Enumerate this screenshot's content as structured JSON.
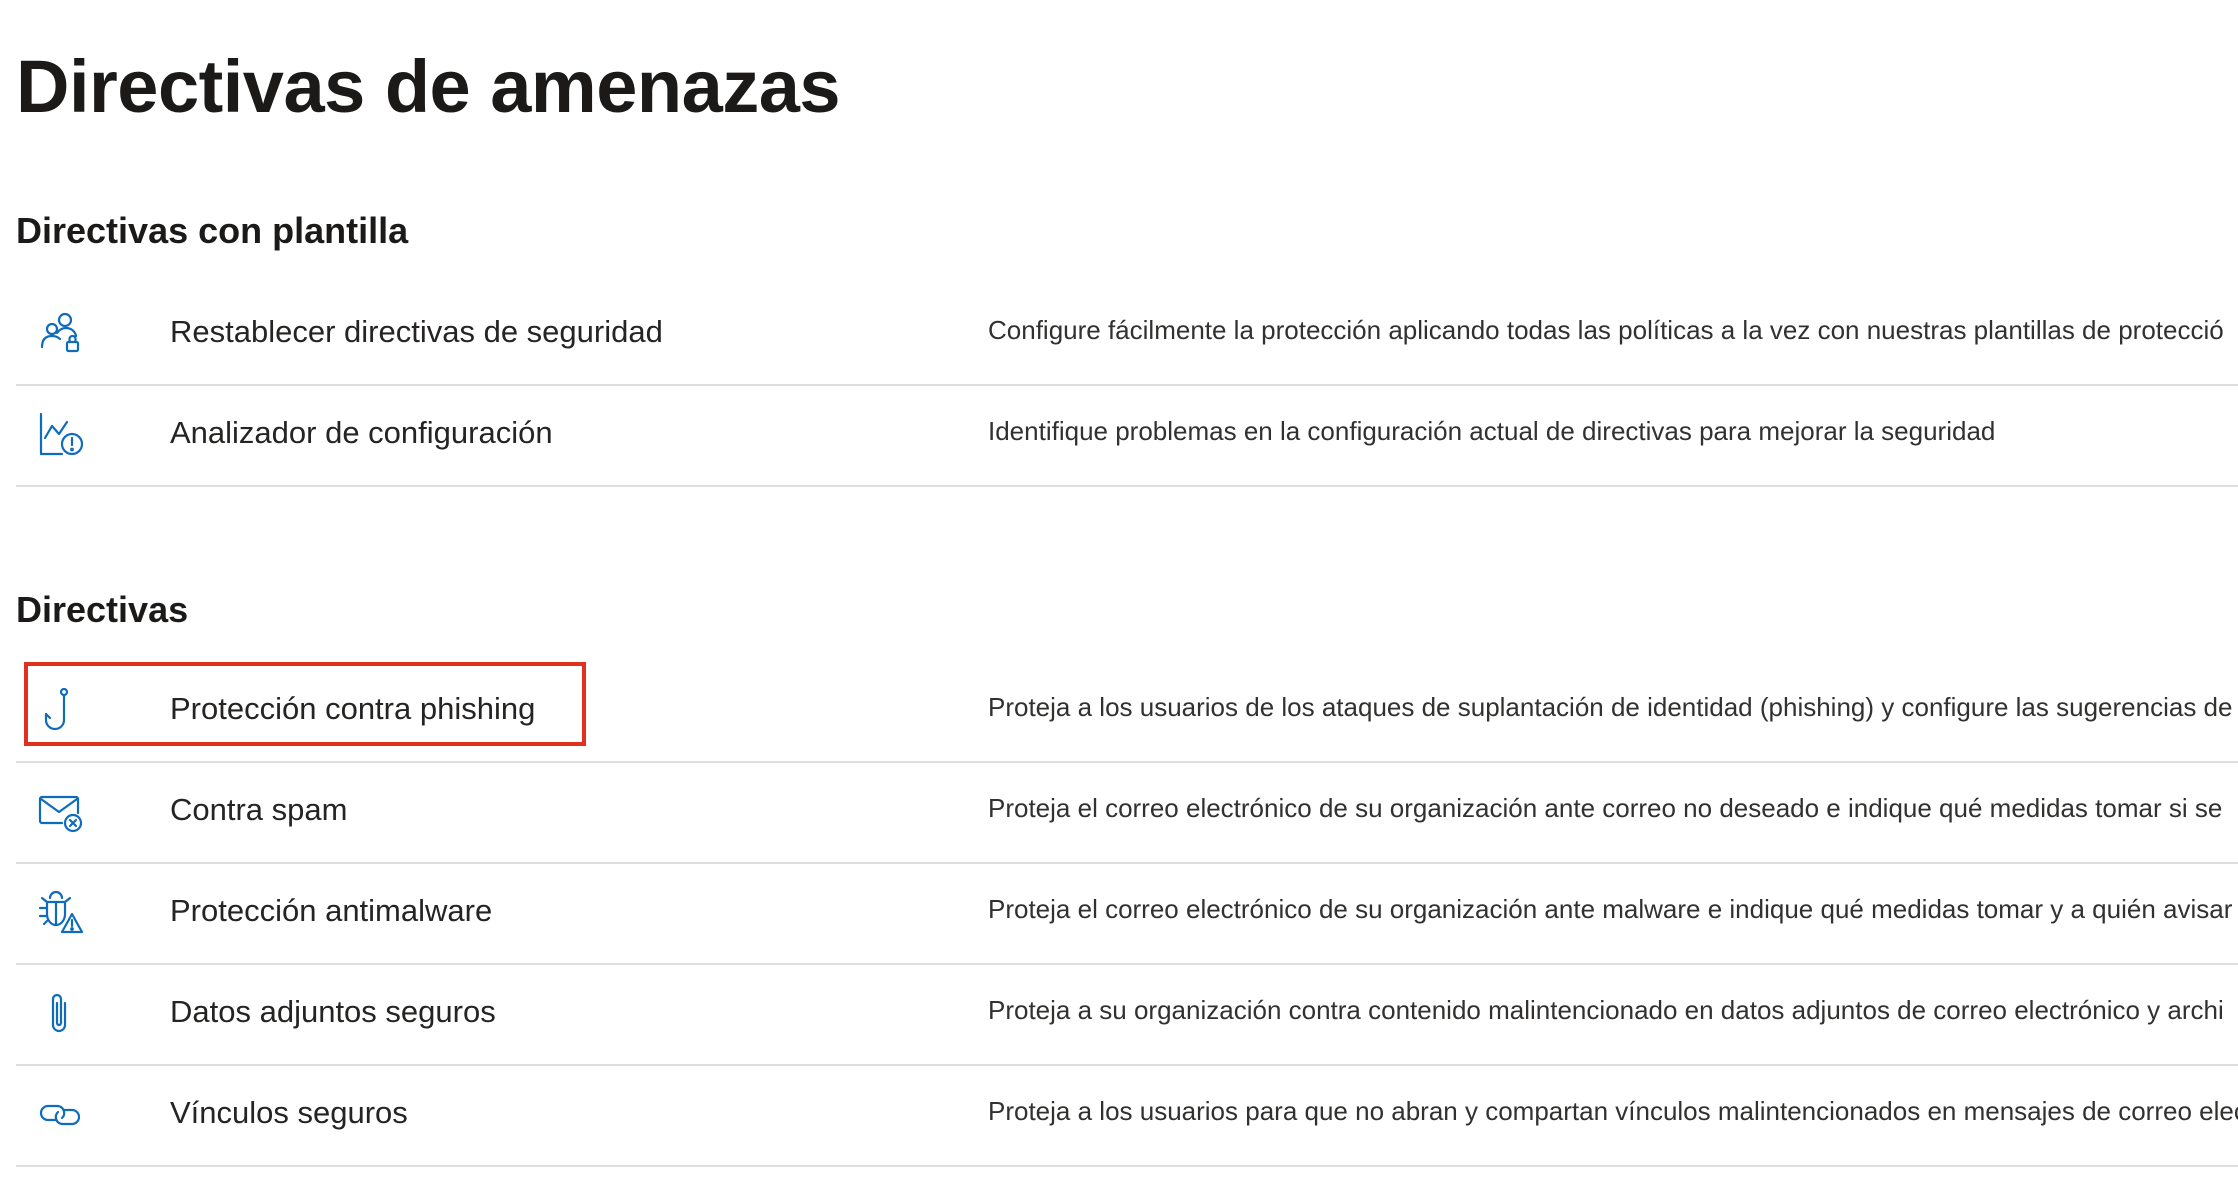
{
  "page": {
    "title": "Directivas de amenazas"
  },
  "templated": {
    "heading": "Directivas con plantilla",
    "items": [
      {
        "icon": "users-lock-icon",
        "label": "Restablecer directivas de seguridad",
        "description": "Configure fácilmente la protección aplicando todas las políticas a la vez con nuestras plantillas de protecció"
      },
      {
        "icon": "chart-warning-icon",
        "label": "Analizador de configuración",
        "description": "Identifique problemas en la configuración actual de directivas para mejorar la seguridad"
      }
    ]
  },
  "policies": {
    "heading": "Directivas",
    "items": [
      {
        "icon": "fishing-hook-icon",
        "label": "Protección contra phishing",
        "description": "Proteja a los usuarios de los ataques de suplantación de identidad (phishing) y configure las sugerencias de",
        "highlighted": true
      },
      {
        "icon": "mail-blocked-icon",
        "label": "Contra spam",
        "description": "Proteja el correo electrónico de su organización ante correo no deseado e indique qué medidas tomar si se"
      },
      {
        "icon": "bug-warning-icon",
        "label": "Protección antimalware",
        "description": "Proteja el correo electrónico de su organización ante malware e indique qué medidas tomar y a quién avisar"
      },
      {
        "icon": "paperclip-icon",
        "label": "Datos adjuntos seguros",
        "description": "Proteja a su organización contra contenido malintencionado en datos adjuntos de correo electrónico y archi"
      },
      {
        "icon": "link-icon",
        "label": "Vínculos seguros",
        "description": "Proteja a los usuarios para que no abran y compartan vínculos malintencionados en mensajes de correo elec"
      }
    ]
  },
  "colors": {
    "accent": "#0f6cbd",
    "highlight": "#e0301e",
    "divider": "#e1dfdd"
  }
}
